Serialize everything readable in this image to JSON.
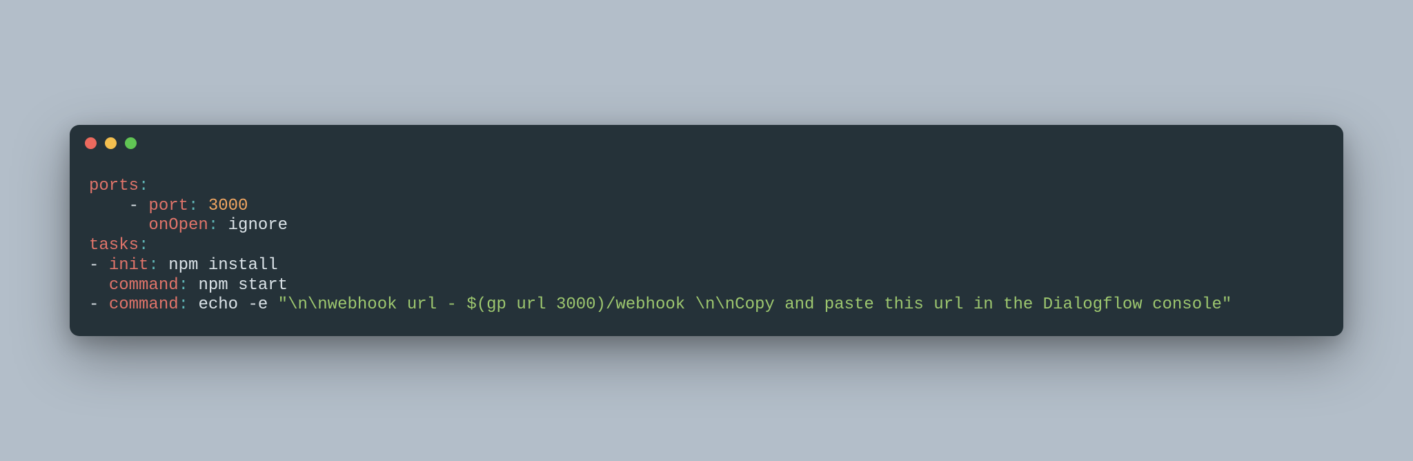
{
  "code": {
    "line1": {
      "key": "ports",
      "colon": ":"
    },
    "line2": {
      "dash": "    - ",
      "key": "port",
      "colon": ": ",
      "value": "3000"
    },
    "line3": {
      "indent": "      ",
      "key": "onOpen",
      "colon": ": ",
      "value": "ignore"
    },
    "line4": {
      "key": "tasks",
      "colon": ":"
    },
    "line5": {
      "dash": "- ",
      "key": "init",
      "colon": ": ",
      "value": "npm install"
    },
    "line6": {
      "indent": "  ",
      "key": "command",
      "colon": ": ",
      "value": "npm start"
    },
    "line7": {
      "dash": "- ",
      "key": "command",
      "colon": ": ",
      "cmd": "echo -e ",
      "string": "\"\\n\\nwebhook url - $(gp url 3000)/webhook \\n\\nCopy and paste this url in the Dialogflow console\""
    }
  }
}
